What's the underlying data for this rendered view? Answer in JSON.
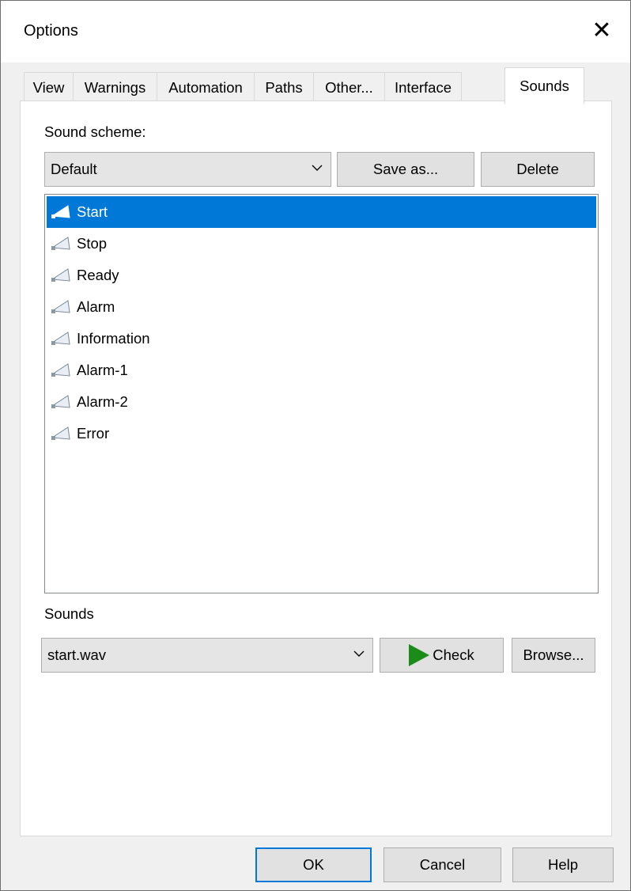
{
  "window": {
    "title": "Options"
  },
  "tabs": [
    {
      "label": "View"
    },
    {
      "label": "Warnings"
    },
    {
      "label": "Automation"
    },
    {
      "label": "Paths"
    },
    {
      "label": "Other..."
    },
    {
      "label": "Interface"
    },
    {
      "label": "Sounds",
      "active": true
    }
  ],
  "sounds_page": {
    "scheme_label": "Sound scheme:",
    "scheme_value": "Default",
    "save_as_label": "Save as...",
    "delete_label": "Delete",
    "events": [
      {
        "label": "Start",
        "selected": true
      },
      {
        "label": "Stop"
      },
      {
        "label": "Ready"
      },
      {
        "label": "Alarm"
      },
      {
        "label": "Information"
      },
      {
        "label": "Alarm-1"
      },
      {
        "label": "Alarm-2"
      },
      {
        "label": "Error"
      }
    ],
    "sounds_label": "Sounds",
    "sound_file": "start.wav",
    "check_label": "Check",
    "browse_label": "Browse..."
  },
  "footer": {
    "ok_label": "OK",
    "cancel_label": "Cancel",
    "help_label": "Help"
  },
  "colors": {
    "selection": "#0078d7",
    "play_icon": "#1a8c1a"
  }
}
